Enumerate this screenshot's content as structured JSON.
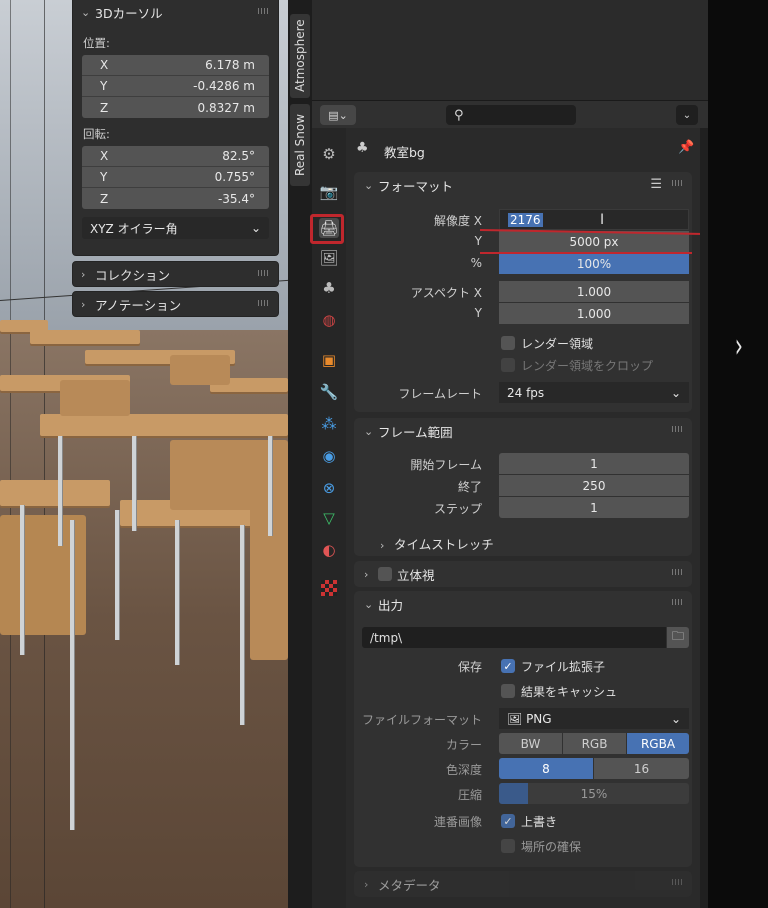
{
  "sidebar_tabs": {
    "atmosphere": "Atmosphere",
    "real_snow": "Real Snow"
  },
  "cursor_panel": {
    "title": "3Dカーソル",
    "location_label": "位置:",
    "location": [
      {
        "axis": "X",
        "value": "6.178 m"
      },
      {
        "axis": "Y",
        "value": "-0.4286 m"
      },
      {
        "axis": "Z",
        "value": "0.8327 m"
      }
    ],
    "rotation_label": "回転:",
    "rotation": [
      {
        "axis": "X",
        "value": "82.5°"
      },
      {
        "axis": "Y",
        "value": "0.755°"
      },
      {
        "axis": "Z",
        "value": "-35.4°"
      }
    ],
    "rotation_mode": "XYZ オイラー角"
  },
  "collection_panel": {
    "title": "コレクション"
  },
  "annotation_panel": {
    "title": "アノテーション"
  },
  "header": {
    "search_placeholder": ""
  },
  "object_name": "教室bg",
  "format": {
    "title": "フォーマット",
    "res_x_label": "解像度 X",
    "res_x": "2176",
    "res_y_label": "Y",
    "res_y": "5000 px",
    "percent_label": "%",
    "percent": "100%",
    "aspect_x_label": "アスペクト X",
    "aspect_x": "1.000",
    "aspect_y_label": "Y",
    "aspect_y": "1.000",
    "render_region": "レンダー領域",
    "crop_region": "レンダー領域をクロップ",
    "frame_rate_label": "フレームレート",
    "frame_rate": "24 fps"
  },
  "frame_range": {
    "title": "フレーム範囲",
    "start_label": "開始フレーム",
    "start": "1",
    "end_label": "終了",
    "end": "250",
    "step_label": "ステップ",
    "step": "1",
    "time_stretch": "タイムストレッチ"
  },
  "stereoscopy": {
    "title": "立体視"
  },
  "output": {
    "title": "出力",
    "path": "/tmp\\",
    "save_label": "保存",
    "file_ext": "ファイル拡張子",
    "cache_result": "結果をキャッシュ",
    "file_format_label": "ファイルフォーマット",
    "file_format": "PNG",
    "color_label": "カラー",
    "color_options": [
      "BW",
      "RGB",
      "RGBA"
    ],
    "color_selected": "RGBA",
    "depth_label": "色深度",
    "depth_options": [
      "8",
      "16"
    ],
    "depth_selected": "8",
    "compression_label": "圧縮",
    "compression": "15%",
    "compression_fraction": 0.15,
    "sequence_label": "連番画像",
    "overwrite": "上書き",
    "placeholders": "場所の確保"
  },
  "metadata": {
    "title": "メタデータ"
  },
  "colors": {
    "accent": "#4772b3",
    "highlight_red": "#c0272d"
  }
}
